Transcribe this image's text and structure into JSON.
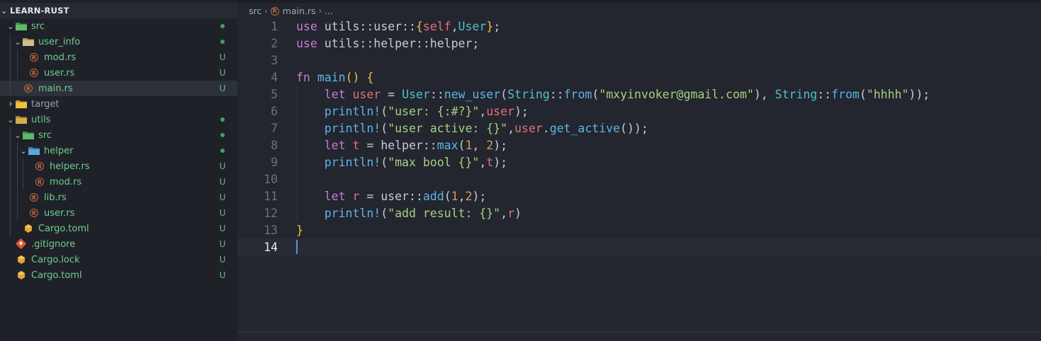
{
  "explorer": {
    "project_name": "LEARN-RUST",
    "tree": [
      {
        "label": "src",
        "kind": "folder",
        "icon": "folder-source-icon",
        "status": "dot",
        "expanded": true,
        "depth": 0
      },
      {
        "label": "user_info",
        "kind": "folder",
        "icon": "folder-icon",
        "status": "dot",
        "expanded": true,
        "depth": 1
      },
      {
        "label": "mod.rs",
        "kind": "file",
        "icon": "rust-file-icon",
        "status": "U",
        "depth": 2
      },
      {
        "label": "user.rs",
        "kind": "file",
        "icon": "rust-file-icon",
        "status": "U",
        "depth": 2
      },
      {
        "label": "main.rs",
        "kind": "file",
        "icon": "rust-file-icon",
        "status": "U",
        "depth": 1,
        "selected": true
      },
      {
        "label": "target",
        "kind": "folder",
        "icon": "folder-target-icon",
        "status": "",
        "expanded": false,
        "depth": 0
      },
      {
        "label": "utils",
        "kind": "folder",
        "icon": "folder-utils-icon",
        "status": "dot",
        "expanded": true,
        "depth": 0
      },
      {
        "label": "src",
        "kind": "folder",
        "icon": "folder-source-icon",
        "status": "dot",
        "expanded": true,
        "depth": 1
      },
      {
        "label": "helper",
        "kind": "folder",
        "icon": "folder-helper-icon",
        "status": "dot",
        "expanded": true,
        "depth": 2
      },
      {
        "label": "helper.rs",
        "kind": "file",
        "icon": "rust-file-icon",
        "status": "U",
        "depth": 3
      },
      {
        "label": "mod.rs",
        "kind": "file",
        "icon": "rust-file-icon",
        "status": "U",
        "depth": 3
      },
      {
        "label": "lib.rs",
        "kind": "file",
        "icon": "rust-file-icon",
        "status": "U",
        "depth": 2
      },
      {
        "label": "user.rs",
        "kind": "file",
        "icon": "rust-file-icon",
        "status": "U",
        "depth": 2
      },
      {
        "label": "Cargo.toml",
        "kind": "file",
        "icon": "cargo-icon",
        "status": "U",
        "depth": 1
      },
      {
        "label": ".gitignore",
        "kind": "file",
        "icon": "git-icon",
        "status": "U",
        "depth": 0
      },
      {
        "label": "Cargo.lock",
        "kind": "file",
        "icon": "cargo-icon",
        "status": "U",
        "depth": 0
      },
      {
        "label": "Cargo.toml",
        "kind": "file",
        "icon": "cargo-icon",
        "status": "U",
        "depth": 0
      }
    ]
  },
  "breadcrumb": {
    "folder": "src",
    "file": "main.rs",
    "more": "..."
  },
  "editor": {
    "active_line": 14,
    "lines": [
      {
        "n": "1",
        "tokens": [
          [
            "k",
            "use"
          ],
          [
            "p",
            " utils"
          ],
          [
            "p",
            "::"
          ],
          [
            "p",
            "user"
          ],
          [
            "p",
            "::"
          ],
          [
            "y",
            "{"
          ],
          [
            "v",
            "self"
          ],
          [
            "p",
            ","
          ],
          [
            "t",
            "User"
          ],
          [
            "y",
            "}"
          ],
          [
            "p",
            ";"
          ]
        ]
      },
      {
        "n": "2",
        "tokens": [
          [
            "k",
            "use"
          ],
          [
            "p",
            " utils"
          ],
          [
            "p",
            "::"
          ],
          [
            "p",
            "helper"
          ],
          [
            "p",
            "::"
          ],
          [
            "p",
            "helper"
          ],
          [
            "p",
            ";"
          ]
        ]
      },
      {
        "n": "3",
        "tokens": []
      },
      {
        "n": "4",
        "tokens": [
          [
            "k",
            "fn"
          ],
          [
            "p",
            " "
          ],
          [
            "f",
            "main"
          ],
          [
            "y",
            "()"
          ],
          [
            "p",
            " "
          ],
          [
            "y",
            "{"
          ]
        ]
      },
      {
        "n": "5",
        "tokens": [
          [
            "p",
            "    "
          ],
          [
            "k",
            "let"
          ],
          [
            "p",
            " "
          ],
          [
            "v",
            "user"
          ],
          [
            "p",
            " = "
          ],
          [
            "t",
            "User"
          ],
          [
            "p",
            "::"
          ],
          [
            "f",
            "new_user"
          ],
          [
            "p",
            "("
          ],
          [
            "t",
            "String"
          ],
          [
            "p",
            "::"
          ],
          [
            "f",
            "from"
          ],
          [
            "p",
            "("
          ],
          [
            "s",
            "\"mxyinvoker@gmail.com\""
          ],
          [
            "p",
            "), "
          ],
          [
            "t",
            "String"
          ],
          [
            "p",
            "::"
          ],
          [
            "f",
            "from"
          ],
          [
            "p",
            "("
          ],
          [
            "s",
            "\"hhhh\""
          ],
          [
            "p",
            "));"
          ]
        ]
      },
      {
        "n": "6",
        "tokens": [
          [
            "p",
            "    "
          ],
          [
            "f",
            "println!"
          ],
          [
            "p",
            "("
          ],
          [
            "s",
            "\"user: {:#?}\""
          ],
          [
            "p",
            ","
          ],
          [
            "v",
            "user"
          ],
          [
            "p",
            ");"
          ]
        ]
      },
      {
        "n": "7",
        "tokens": [
          [
            "p",
            "    "
          ],
          [
            "f",
            "println!"
          ],
          [
            "p",
            "("
          ],
          [
            "s",
            "\"user active: {}\""
          ],
          [
            "p",
            ","
          ],
          [
            "v",
            "user"
          ],
          [
            "p",
            "."
          ],
          [
            "f",
            "get_active"
          ],
          [
            "p",
            "());"
          ]
        ]
      },
      {
        "n": "8",
        "tokens": [
          [
            "p",
            "    "
          ],
          [
            "k",
            "let"
          ],
          [
            "p",
            " "
          ],
          [
            "v",
            "t"
          ],
          [
            "p",
            " = "
          ],
          [
            "p",
            "helper"
          ],
          [
            "p",
            "::"
          ],
          [
            "f",
            "max"
          ],
          [
            "p",
            "("
          ],
          [
            "n",
            "1"
          ],
          [
            "p",
            ", "
          ],
          [
            "n",
            "2"
          ],
          [
            "p",
            ");"
          ]
        ]
      },
      {
        "n": "9",
        "tokens": [
          [
            "p",
            "    "
          ],
          [
            "f",
            "println!"
          ],
          [
            "p",
            "("
          ],
          [
            "s",
            "\"max bool {}\""
          ],
          [
            "p",
            ","
          ],
          [
            "v",
            "t"
          ],
          [
            "p",
            ");"
          ]
        ]
      },
      {
        "n": "10",
        "tokens": []
      },
      {
        "n": "11",
        "tokens": [
          [
            "p",
            "    "
          ],
          [
            "k",
            "let"
          ],
          [
            "p",
            " "
          ],
          [
            "v",
            "r"
          ],
          [
            "p",
            " = "
          ],
          [
            "p",
            "user"
          ],
          [
            "p",
            "::"
          ],
          [
            "f",
            "add"
          ],
          [
            "p",
            "("
          ],
          [
            "n",
            "1"
          ],
          [
            "p",
            ","
          ],
          [
            "n",
            "2"
          ],
          [
            "p",
            ");"
          ]
        ]
      },
      {
        "n": "12",
        "tokens": [
          [
            "p",
            "    "
          ],
          [
            "f",
            "println!"
          ],
          [
            "p",
            "("
          ],
          [
            "s",
            "\"add result: {}\""
          ],
          [
            "p",
            ","
          ],
          [
            "v",
            "r"
          ],
          [
            "p",
            ")"
          ]
        ]
      },
      {
        "n": "13",
        "tokens": [
          [
            "y",
            "}"
          ]
        ]
      },
      {
        "n": "14",
        "tokens": []
      }
    ]
  },
  "colors": {
    "sidebar_bg": "#1f2128",
    "editor_bg": "#23262e",
    "tree_text": "#6fcf8e",
    "untracked": "#5fbf7a",
    "keyword": "#c87dd6",
    "function": "#5fb3e8",
    "type": "#4fc1c9",
    "string": "#a7d083",
    "variable": "#e4707a",
    "number": "#d99a5e",
    "bracket": "#e8c34a",
    "cursor": "#5f8fe0"
  }
}
